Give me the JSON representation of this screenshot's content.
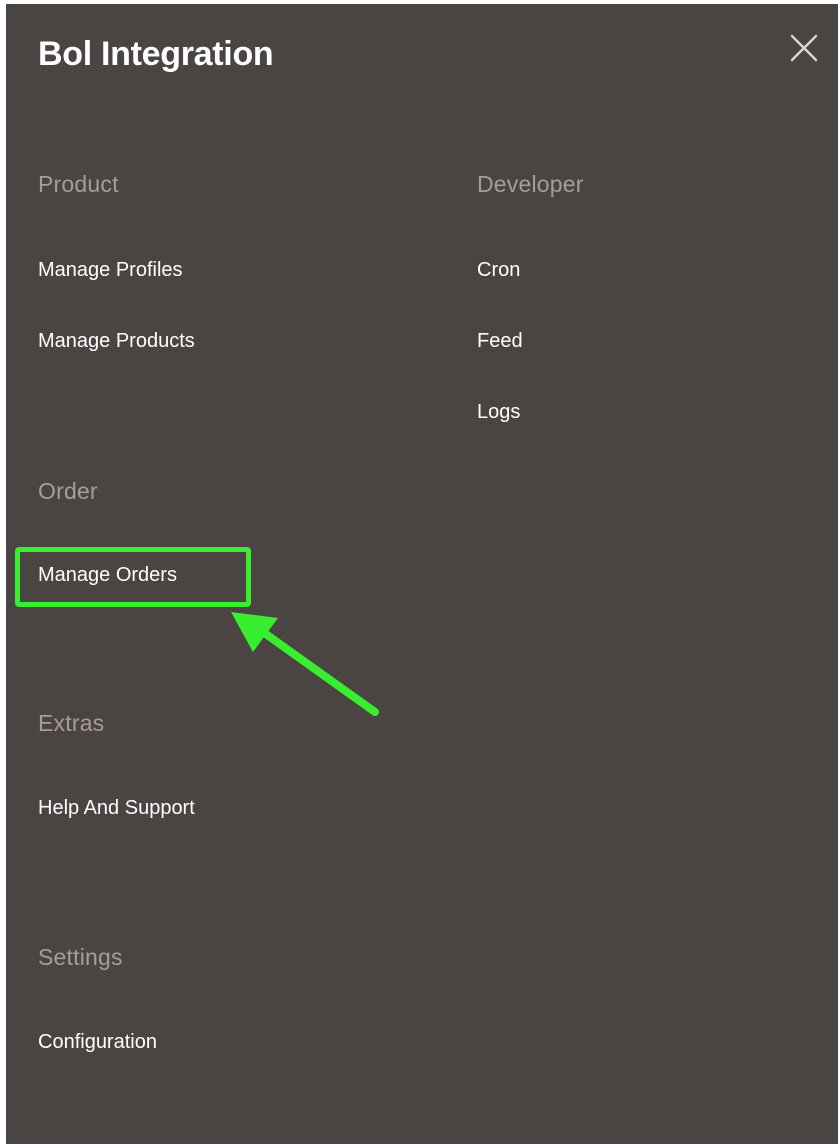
{
  "panel": {
    "title": "Bol Integration",
    "close_icon": "close-icon"
  },
  "sections": {
    "product": {
      "title": "Product",
      "items": [
        "Manage Profiles",
        "Manage Products"
      ]
    },
    "developer": {
      "title": "Developer",
      "items": [
        "Cron",
        "Feed",
        "Logs"
      ]
    },
    "order": {
      "title": "Order",
      "items": [
        "Manage Orders"
      ]
    },
    "extras": {
      "title": "Extras",
      "items": [
        "Help And Support"
      ]
    },
    "settings": {
      "title": "Settings",
      "items": [
        "Configuration"
      ]
    }
  },
  "annotation": {
    "highlight_color": "#38ee2f",
    "target": "Manage Orders"
  },
  "colors": {
    "background": "#4a4542",
    "section_title": "#a79d95",
    "link": "#ffffff"
  }
}
